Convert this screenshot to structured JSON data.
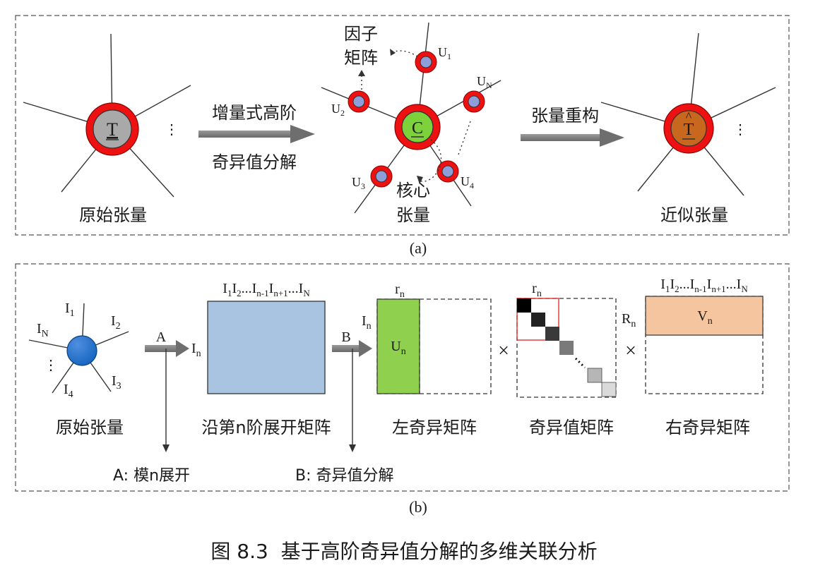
{
  "panel_a": {
    "caption": "(a)",
    "original": {
      "symbol": "T",
      "label": "原始张量",
      "ellipsis": "⋮"
    },
    "arrow1": {
      "line1": "增量式高阶",
      "line2": "奇异值分解"
    },
    "core": {
      "symbol": "C",
      "label_line1": "核心",
      "label_line2": "张量",
      "factor_line1": "因子",
      "factor_line2": "矩阵",
      "nodes": [
        {
          "base": "U",
          "sub": "1"
        },
        {
          "base": "U",
          "sub": "2"
        },
        {
          "base": "U",
          "sub": "3"
        },
        {
          "base": "U",
          "sub": "4"
        },
        {
          "base": "U",
          "sub": "N"
        }
      ]
    },
    "arrow2": {
      "label": "张量重构"
    },
    "approx": {
      "symbol": "T",
      "hat": "^",
      "label": "近似张量",
      "ellipsis": "⋮"
    },
    "colors": {
      "ring": "#ee1111",
      "original_fill": "#a9a9a9",
      "core_fill": "#7dd23c",
      "approx_fill": "#c8681e",
      "factor_fill": "#8e9ed8"
    }
  },
  "panel_b": {
    "caption": "(b)",
    "tensor": {
      "label": "原始张量",
      "edges": [
        {
          "base": "I",
          "sub": "1"
        },
        {
          "base": "I",
          "sub": "2"
        },
        {
          "base": "I",
          "sub": "3"
        },
        {
          "base": "I",
          "sub": "4"
        },
        {
          "base": "I",
          "sub": "N"
        }
      ],
      "dots": "⋮"
    },
    "arrow_a": "A",
    "arrow_b": "B",
    "unfold": {
      "label": "沿第n阶展开矩阵",
      "cols": {
        "p1": "I",
        "s1": "1",
        "p2": "I",
        "s2": "2",
        "p3": "...I",
        "s3": "n-1",
        "p4": "I",
        "s4": "n+1",
        "p5": "...I",
        "s5": "N"
      },
      "rows": {
        "base": "I",
        "sub": "n"
      }
    },
    "left": {
      "label": "左奇异矩阵",
      "block": {
        "base": "U",
        "sub": "n"
      },
      "cols": {
        "base": "r",
        "sub": "n"
      },
      "rows": {
        "base": "I",
        "sub": "n"
      }
    },
    "times": "×",
    "singular": {
      "label": "奇异值矩阵",
      "cols": {
        "base": "r",
        "sub": "n"
      }
    },
    "right": {
      "label": "右奇异矩阵",
      "block": {
        "base": "V",
        "sub": "n"
      },
      "rows": {
        "base": "R",
        "sub": "n"
      },
      "cols": {
        "p1": "I",
        "s1": "1",
        "p2": "I",
        "s2": "2",
        "p3": "...I",
        "s3": "n-1",
        "p4": "I",
        "s4": "n+1",
        "p5": "...I",
        "s5": "N"
      }
    },
    "note_a": "A: 模n展开",
    "note_b": "B: 奇异值分解",
    "colors": {
      "tensor_fill": "#1565c0",
      "unfold_fill": "#a8c4e0",
      "left_fill": "#8fd14f",
      "right_fill": "#f5c59f"
    }
  },
  "figure_caption": "图 8.3  基于高阶奇异值分解的多维关联分析"
}
